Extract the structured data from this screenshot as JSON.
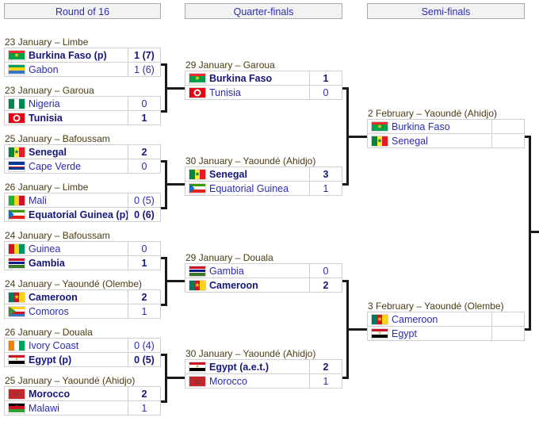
{
  "rounds": [
    {
      "id": "round-of-16",
      "label": "Round of 16"
    },
    {
      "id": "quarter-finals",
      "label": "Quarter-finals"
    },
    {
      "id": "semi-finals",
      "label": "Semi-finals"
    }
  ],
  "matches": {
    "r16_1": {
      "date": "23 January – Limbe",
      "home": {
        "team": "Burkina Faso (p)",
        "score": "1 (7)",
        "winner": true,
        "flag": "burkina-faso"
      },
      "away": {
        "team": "Gabon",
        "score": "1 (6)",
        "winner": false,
        "flag": "gabon"
      }
    },
    "r16_2": {
      "date": "23 January – Garoua",
      "home": {
        "team": "Nigeria",
        "score": "0",
        "winner": false,
        "flag": "nigeria"
      },
      "away": {
        "team": "Tunisia",
        "score": "1",
        "winner": true,
        "flag": "tunisia"
      }
    },
    "r16_3": {
      "date": "25 January – Bafoussam",
      "home": {
        "team": "Senegal",
        "score": "2",
        "winner": true,
        "flag": "senegal"
      },
      "away": {
        "team": "Cape Verde",
        "score": "0",
        "winner": false,
        "flag": "cape-verde"
      }
    },
    "r16_4": {
      "date": "26 January – Limbe",
      "home": {
        "team": "Mali",
        "score": "0 (5)",
        "winner": false,
        "flag": "mali"
      },
      "away": {
        "team": "Equatorial Guinea (p)",
        "score": "0 (6)",
        "winner": true,
        "flag": "equatorial-guinea"
      }
    },
    "r16_5": {
      "date": "24 January – Bafoussam",
      "home": {
        "team": "Guinea",
        "score": "0",
        "winner": false,
        "flag": "guinea"
      },
      "away": {
        "team": "Gambia",
        "score": "1",
        "winner": true,
        "flag": "gambia"
      }
    },
    "r16_6": {
      "date": "24 January – Yaoundé (Olembe)",
      "home": {
        "team": "Cameroon",
        "score": "2",
        "winner": true,
        "flag": "cameroon"
      },
      "away": {
        "team": "Comoros",
        "score": "1",
        "winner": false,
        "flag": "comoros"
      }
    },
    "r16_7": {
      "date": "26 January – Douala",
      "home": {
        "team": "Ivory Coast",
        "score": "0 (4)",
        "winner": false,
        "flag": "ivory-coast"
      },
      "away": {
        "team": "Egypt (p)",
        "score": "0 (5)",
        "winner": true,
        "flag": "egypt"
      }
    },
    "r16_8": {
      "date": "25 January – Yaoundé (Ahidjo)",
      "home": {
        "team": "Morocco",
        "score": "2",
        "winner": true,
        "flag": "morocco"
      },
      "away": {
        "team": "Malawi",
        "score": "1",
        "winner": false,
        "flag": "malawi"
      }
    },
    "qf_1": {
      "date": "29 January – Garoua",
      "home": {
        "team": "Burkina Faso",
        "score": "1",
        "winner": true,
        "flag": "burkina-faso"
      },
      "away": {
        "team": "Tunisia",
        "score": "0",
        "winner": false,
        "flag": "tunisia"
      }
    },
    "qf_2": {
      "date": "30 January – Yaoundé (Ahidjo)",
      "home": {
        "team": "Senegal",
        "score": "3",
        "winner": true,
        "flag": "senegal"
      },
      "away": {
        "team": "Equatorial Guinea",
        "score": "1",
        "winner": false,
        "flag": "equatorial-guinea"
      }
    },
    "qf_3": {
      "date": "29 January – Douala",
      "home": {
        "team": "Gambia",
        "score": "0",
        "winner": false,
        "flag": "gambia"
      },
      "away": {
        "team": "Cameroon",
        "score": "2",
        "winner": true,
        "flag": "cameroon"
      }
    },
    "qf_4": {
      "date": "30 January – Yaoundé (Ahidjo)",
      "home": {
        "team": "Egypt (a.e.t.)",
        "score": "2",
        "winner": true,
        "flag": "egypt"
      },
      "away": {
        "team": "Morocco",
        "score": "1",
        "winner": false,
        "flag": "morocco"
      }
    },
    "sf_1": {
      "date": "2 February – Yaoundé (Ahidjo)",
      "home": {
        "team": "Burkina Faso",
        "score": "",
        "winner": false,
        "flag": "burkina-faso"
      },
      "away": {
        "team": "Senegal",
        "score": "",
        "winner": false,
        "flag": "senegal"
      }
    },
    "sf_2": {
      "date": "3 February – Yaoundé (Olembe)",
      "home": {
        "team": "Cameroon",
        "score": "",
        "winner": false,
        "flag": "cameroon"
      },
      "away": {
        "team": "Egypt",
        "score": "",
        "winner": false,
        "flag": "egypt"
      }
    }
  },
  "colors": {
    "link": "#2b2bb0",
    "header_bg": "#f2f2f2",
    "border": "#cfcfcf",
    "connector": "#1a1a1a",
    "date_text": "#4b3b12"
  }
}
